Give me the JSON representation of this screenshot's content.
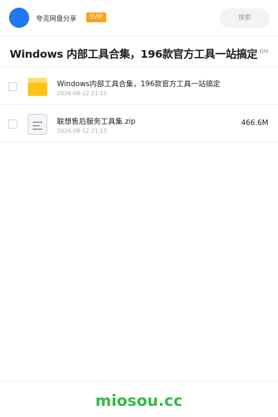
{
  "header": {
    "app_name": "夸克网盘分享",
    "badge": "SVIP",
    "search_placeholder": "搜索",
    "avatar_color": "#1f78f0",
    "badge_color": "#f7a21e"
  },
  "share": {
    "title": "Windows 内部工具合集，196款官方工具一站搞定",
    "total_size": "466.6M"
  },
  "files": [
    {
      "icon": "folder-icon",
      "name": "Windows内部工具合集，196款官方工具一站搞定",
      "date": "2026-08-12 21:15",
      "size": ""
    },
    {
      "icon": "zip-file-icon",
      "name": "联想售后服务工具集.zip",
      "date": "2026-08-12 21:15",
      "size": "466.6M"
    }
  ],
  "footer": {
    "brand": "miosou.cc",
    "brand_color": "#35b84a"
  }
}
